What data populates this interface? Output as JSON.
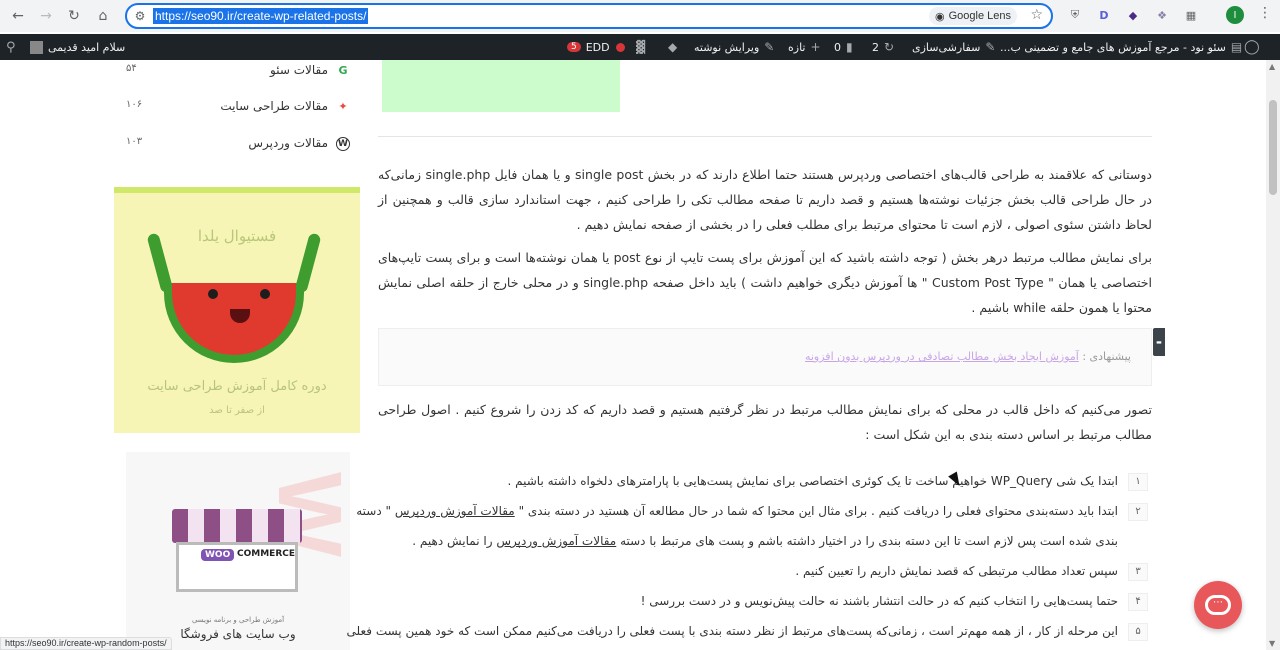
{
  "browser": {
    "url": "https://seo90.ir/create-wp-related-posts/",
    "lens_label": "Google Lens",
    "profile_initial": "I",
    "status_url": "https://seo90.ir/create-wp-random-posts/"
  },
  "adminbar": {
    "site_name": "سئو نود - مرجع آموزش های جامع و تضمینی ب...",
    "customize": "سفارشی‌سازی",
    "updates_count": "2",
    "comments_count": "0",
    "new_label": "تازه",
    "edit_post": "ویرایش نوشته",
    "edd_label": "EDD",
    "edd_count": "5",
    "greeting": "سلام امید قدیمی"
  },
  "sidebar": {
    "categories": [
      {
        "name": "مقالات سئو",
        "count": "۵۴",
        "icon": "google-g-icon"
      },
      {
        "name": "مقالات طراحی سایت",
        "count": "۱۰۶",
        "icon": "design-icon"
      },
      {
        "name": "مقالات وردپرس",
        "count": "۱۰۳",
        "icon": "wordpress-icon"
      }
    ],
    "banner1": {
      "festival": "فستیوال یلدا",
      "title": "دوره کامل آموزش طراحی سایت",
      "subtitle": "از صفر تا صد"
    },
    "banner2": {
      "logo_woo": "WOO",
      "logo_commerce": "COMMERCE",
      "small_caption": "آموزش طراحی و برنامه نویسی",
      "title": "وب سایت های فروشگا"
    }
  },
  "article": {
    "p1": "دوستانی که علاقمند به طراحی قالب‌های اختصاصی وردپرس هستند حتما اطلاع دارند که در بخش single post و یا همان فایل single.php زمانی‌که در حال طراحی قالب بخش جزئیات نوشته‌ها هستیم و قصد داریم تا صفحه مطالب تکی را طراحی کنیم ، جهت استاندارد سازی قالب و همچنین از لحاظ داشتن سئوی اصولی ، لازم است تا محتوای مرتبط برای مطلب فعلی را در بخشی از صفحه نمایش دهیم .",
    "p2": "برای نمایش مطالب مرتبط درهر بخش ( توجه داشته باشید که این آموزش برای پست تایپ از نوع post یا همان نوشته‌ها است و برای پست تایپ‌های اختصاصی یا همان \" Custom Post Type \" ها آموزش دیگری خواهیم داشت ) باید داخل صفحه single.php و در محلی خارج از حلقه اصلی نمایش محتوا یا همون حلقه while باشیم .",
    "suggest_prefix": "پیشنهادی :",
    "suggest_link": "آموزش ایجاد بخش مطالب تصادفی در وردپرس بدون افزونه",
    "p3": "تصور می‌کنیم که داخل قالب در محلی که برای نمایش مطالب مرتبط در نظر گرفتیم هستیم و قصد داریم که کد زدن را شروع کنیم . اصول طراحی مطالب مرتبط بر اساس دسته بندی به این شکل است :",
    "list": [
      {
        "num": "۱",
        "text": "ابتدا یک شی WP_Query خواهیم ساخت تا یک کوئری اختصاصی برای نمایش پست‌هایی با پارامترهای دلخواه داشته باشیم ."
      },
      {
        "num": "۲",
        "text_a": "ابتدا باید دسته‌بندی محتوای فعلی را دریافت کنیم . برای مثال این محتوا که شما در حال مطالعه آن هستید در دسته بندی \"",
        "link_a": "مقالات آموزش وردپرس",
        "text_b": "\" دسته"
      },
      {
        "num": "",
        "text_a": "بندی شده است پس لازم است تا این دسته بندی را در اختیار داشته باشم و پست های مرتبط با دسته",
        "link_a": "مقالات آموزش وردپرس",
        "text_b": "را نمایش دهیم ."
      },
      {
        "num": "۳",
        "text": "سپس تعداد مطالب مرتبطی که قصد نمایش داریم را تعیین کنیم ."
      },
      {
        "num": "۴",
        "text": "حتما پست‌هایی را انتخاب کنیم که در حالت انتشار باشند نه حالت پیش‌نویس و در دست بررسی !"
      },
      {
        "num": "۵",
        "text": "این مرحله از کار ، از همه مهم‌تر است ، زمانی‌که پست‌های مرتبط از نظر دسته بندی با پست فعلی را دریافت می‌کنیم ممکن است که خود همین پست فعلی"
      }
    ]
  }
}
